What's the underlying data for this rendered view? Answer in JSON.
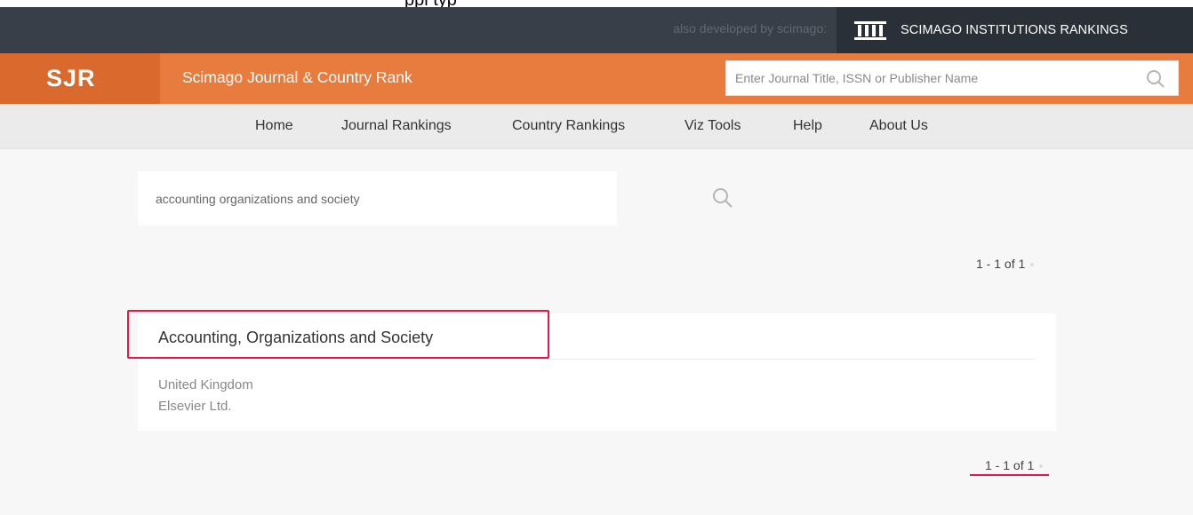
{
  "top_clip_text": "ppl typ",
  "topbar": {
    "also_text": "also developed by scimago:",
    "sir_label": "SCIMAGO INSTITUTIONS RANKINGS"
  },
  "header": {
    "logo": "SJR",
    "title": "Scimago Journal & Country Rank",
    "search_placeholder": "Enter Journal Title, ISSN or Publisher Name"
  },
  "nav": {
    "items": [
      "Home",
      "Journal Rankings",
      "Country Rankings",
      "Viz Tools",
      "Help",
      "About Us"
    ]
  },
  "search": {
    "value": "accounting organizations and society"
  },
  "pagination": {
    "top": "1 - 1 of 1",
    "bottom": "1 - 1 of 1"
  },
  "results": [
    {
      "title": "Accounting, Organizations and Society",
      "country": "United Kingdom",
      "publisher": "Elsevier Ltd."
    }
  ],
  "colors": {
    "orange": "#e87c3e",
    "dark": "#383f48",
    "highlight": "#e8174a"
  }
}
